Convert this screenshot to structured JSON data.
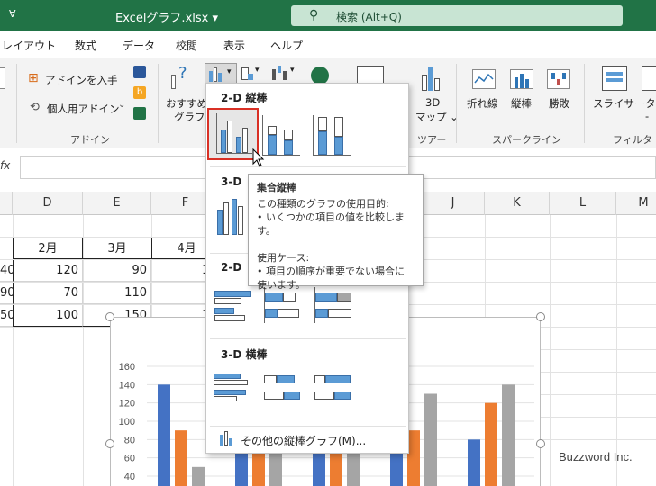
{
  "titlebar": {
    "quick_access_icon": "chevron-down-icon",
    "filename": "Excelグラフ.xlsx",
    "search_placeholder": "検索 (Alt+Q)"
  },
  "menu": {
    "tabs": [
      "レイアウト",
      "数式",
      "データ",
      "校閲",
      "表示",
      "ヘルプ"
    ]
  },
  "ribbon": {
    "addin_get": "アドインを入手",
    "addin_personal": "個人用アドイン",
    "addin_group": "アドイン",
    "recommended_line1": "おすすめ",
    "recommended_line2": "グラフ",
    "map3d_line1": "3D",
    "map3d_line2": "マップ",
    "tour_group": "ツアー",
    "spark_line": "折れ線",
    "spark_column": "縦棒",
    "spark_winloss": "勝敗",
    "sparkline_group": "スパークライン",
    "slicer": "スライサー",
    "timeline_partial": "タ",
    "filter_group": "フィルター"
  },
  "formula": {
    "name_box_partial": "fx"
  },
  "grid": {
    "columns": [
      "D",
      "E",
      "F",
      "J",
      "K",
      "L",
      "M"
    ],
    "header_row": [
      "2月",
      "3月",
      "4月"
    ],
    "rows": [
      {
        "partial": "40",
        "d": "120",
        "e": "90",
        "f": "1"
      },
      {
        "partial": "90",
        "d": "70",
        "e": "110",
        "f": ""
      },
      {
        "partial": "50",
        "d": "100",
        "e": "150",
        "f": "1"
      }
    ]
  },
  "chart_data": {
    "type": "bar",
    "yticks": [
      "160",
      "140",
      "120",
      "100",
      "80",
      "60",
      "40"
    ],
    "ylim": [
      40,
      160
    ],
    "series": [
      {
        "color": "#4472c4",
        "values": [
          140,
          120,
          90,
          110,
          80
        ]
      },
      {
        "color": "#ed7d31",
        "values": [
          90,
          70,
          110,
          90,
          120
        ]
      },
      {
        "color": "#a5a5a5",
        "values": [
          50,
          100,
          100,
          130,
          140
        ]
      }
    ]
  },
  "dropdown": {
    "section_2d_col": "2-D 縦棒",
    "section_3d_col": "3-D 縦棒",
    "section_3d_col_visible": "3-D",
    "section_2d_bar_visible": "2-D",
    "section_3d_bar": "3-D 横棒",
    "more_charts": "その他の縦棒グラフ(M)..."
  },
  "tooltip": {
    "title": "集合縦棒",
    "purpose_heading": "この種類のグラフの使用目的:",
    "purpose_item": "• いくつかの項目の値を比較します。",
    "usecase_heading": "使用ケース:",
    "usecase_item_line1": "• 項目の順序が重要でない場合に",
    "usecase_item_line2": "使います。"
  },
  "watermark": "Buzzword Inc.",
  "colors": {
    "excel_green": "#217346",
    "highlight_red": "#d93025",
    "bar_blue": "#5b9bd5"
  }
}
